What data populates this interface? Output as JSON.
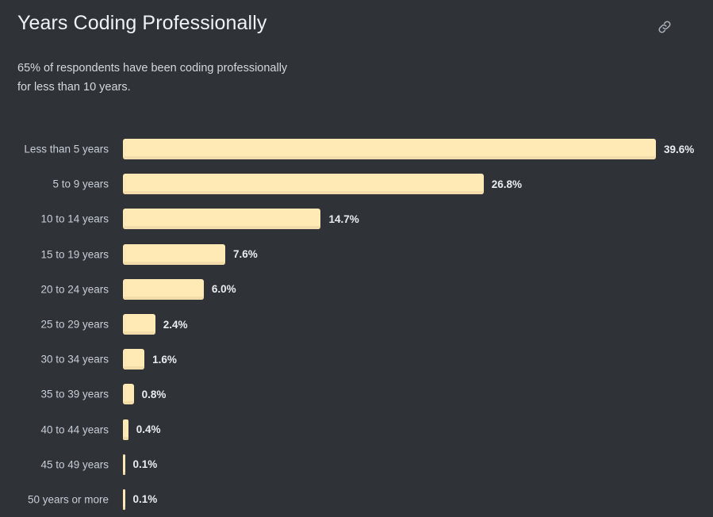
{
  "header": {
    "title": "Years Coding Professionally",
    "subtitle": "65% of respondents have been coding professionally\nfor less than 10 years.",
    "link_icon": "link-icon"
  },
  "colors": {
    "background": "#2f3337",
    "bar_fill": "#ffe9b4",
    "bar_shadow": "#f2dca9",
    "title_text": "#eef1f5",
    "category_text": "#c8ced6",
    "value_text": "#e9edf2"
  },
  "chart_data": {
    "type": "bar",
    "orientation": "horizontal",
    "title": "Years Coding Professionally",
    "subtitle": "65% of respondents have been coding professionally for less than 10 years.",
    "xlabel": "",
    "ylabel": "",
    "grid": false,
    "legend": false,
    "xlim": [
      0,
      39.6
    ],
    "categories": [
      "Less than 5 years",
      "5 to 9 years",
      "10 to 14 years",
      "15 to 19 years",
      "20 to 24 years",
      "25 to 29 years",
      "30 to 34 years",
      "35 to 39 years",
      "40 to 44 years",
      "45 to 49 years",
      "50 years or more"
    ],
    "values": [
      39.6,
      26.8,
      14.7,
      7.6,
      6.0,
      2.4,
      1.6,
      0.8,
      0.4,
      0.1,
      0.1
    ],
    "value_labels": [
      "39.6%",
      "26.8%",
      "14.7%",
      "7.6%",
      "6.0%",
      "2.4%",
      "1.6%",
      "0.8%",
      "0.4%",
      "0.1%",
      "0.1%"
    ]
  }
}
